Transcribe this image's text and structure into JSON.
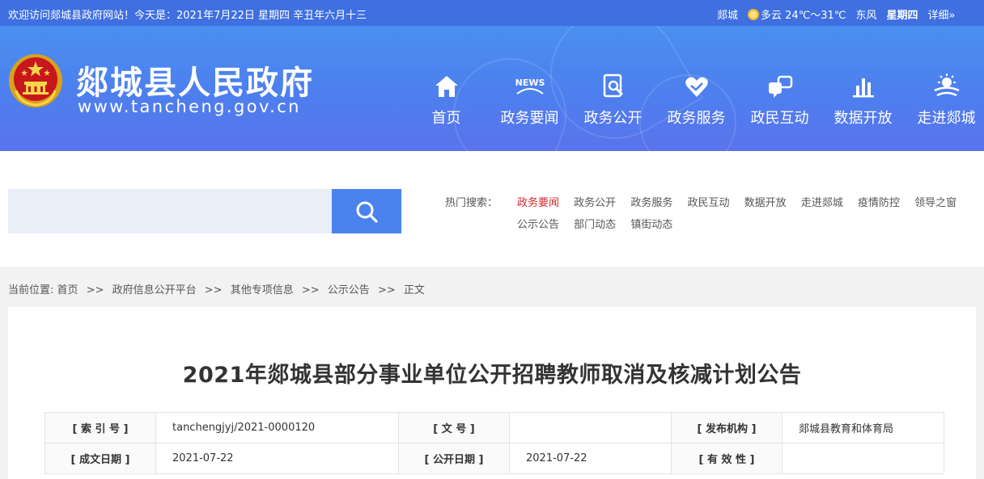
{
  "topbar": {
    "welcome": "欢迎访问郯城县政府网站！今天是：2021年7月22日  星期四  辛丑年六月十三",
    "city": "郯城",
    "weather": "多云 24℃～31℃",
    "wind": "东风",
    "weekday": "星期四",
    "detail": "详细»"
  },
  "header": {
    "site_name": "郯城县人民政府",
    "site_url": "www.tancheng.gov.cn",
    "nav": [
      {
        "label": "首页",
        "icon": "home-icon"
      },
      {
        "label": "政务要闻",
        "icon": "news-icon",
        "badge": "NEWS"
      },
      {
        "label": "政务公开",
        "icon": "document-search-icon"
      },
      {
        "label": "政务服务",
        "icon": "heart-hands-icon"
      },
      {
        "label": "政民互动",
        "icon": "interaction-icon"
      },
      {
        "label": "数据开放",
        "icon": "bar-chart-icon"
      },
      {
        "label": "走进郯城",
        "icon": "sun-landscape-icon"
      }
    ]
  },
  "search": {
    "placeholder": "",
    "hot_label": "热门搜索：",
    "hot_row1": [
      "政务要闻",
      "政务公开",
      "政务服务",
      "政民互动",
      "数据开放",
      "走进郯城",
      "疫情防控",
      "领导之窗"
    ],
    "hot_row2": [
      "公示公告",
      "部门动态",
      "镇街动态"
    ]
  },
  "breadcrumb": {
    "prefix": "当前位置: ",
    "items": [
      "首页",
      "政府信息公开平台",
      "其他专项信息",
      "公示公告",
      "正文"
    ],
    "sep": ">>"
  },
  "article": {
    "title": "2021年郯城县部分事业单位公开招聘教师取消及核减计划公告",
    "meta": {
      "index_label": "[ 索 引 号 ]",
      "index_value": "tanchengjyj/2021-0000120",
      "doc_label": "[ 文      号 ]",
      "doc_value": "",
      "org_label": "[ 发布机构 ]",
      "org_value": "郯城县教育和体育局",
      "created_label": "[ 成文日期 ]",
      "created_value": "2021-07-22",
      "public_label": "[ 公开日期 ]",
      "public_value": "2021-07-22",
      "valid_label": "[ 有 效 性 ]",
      "valid_value": ""
    }
  },
  "colors": {
    "topbar": "#3f6fe0",
    "header_top": "#4a8ff0",
    "header_bottom": "#5a73ec",
    "search_button": "#4a83ee",
    "hot_active": "#d3282b"
  }
}
